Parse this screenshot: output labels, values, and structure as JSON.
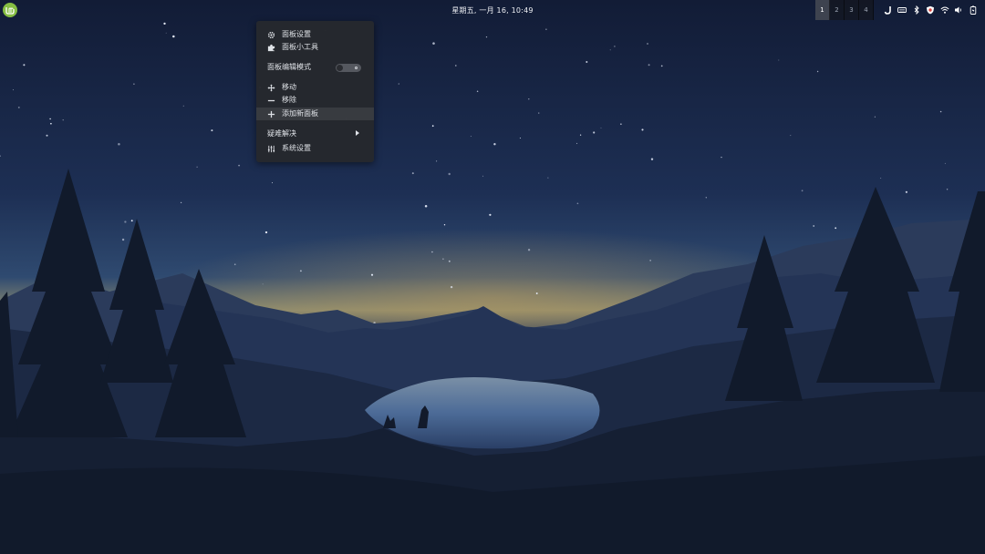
{
  "colors": {
    "sky_top": "#13203d",
    "sky_mid": "#223961",
    "horizon_glow": "#c9a86a",
    "mountains_far": "#2a3a5c",
    "mountains_near": "#1b2840",
    "lake": "#5170a0",
    "trees": "#0f1626",
    "menu_bg": "#26282d",
    "mint_green": "#86be43"
  },
  "panel": {
    "menu_button_icon": "linux-mint-logo",
    "clock_text": "星期五, 一月 16, 10:49",
    "workspaces": [
      {
        "label": "1",
        "active": true
      },
      {
        "label": "2",
        "active": false
      },
      {
        "label": "3",
        "active": false
      },
      {
        "label": "4",
        "active": false
      }
    ],
    "tray_icons": [
      "app-indicator-icon",
      "keyboard-icon",
      "bluetooth-icon",
      "update-shield-icon",
      "wifi-icon",
      "volume-icon",
      "battery-icon"
    ]
  },
  "panel_menu": {
    "items": [
      {
        "id": "panel-settings",
        "label": "面板设置",
        "icon": "gear-icon"
      },
      {
        "id": "panel-applets",
        "label": "面板小工具",
        "icon": "puzzle-icon"
      },
      {
        "id": "panel-edit-mode",
        "label": "面板编辑模式",
        "toggle": false
      },
      {
        "id": "move",
        "label": "移动",
        "icon": "move-icon"
      },
      {
        "id": "remove",
        "label": "移除",
        "icon": "minus-icon"
      },
      {
        "id": "add-new-panel",
        "label": "添加新面板",
        "icon": "plus-icon",
        "highlighted": true
      },
      {
        "id": "troubleshoot",
        "label": "疑难解决",
        "submenu": true
      },
      {
        "id": "system-settings",
        "label": "系统设置",
        "icon": "sliders-icon"
      }
    ]
  }
}
